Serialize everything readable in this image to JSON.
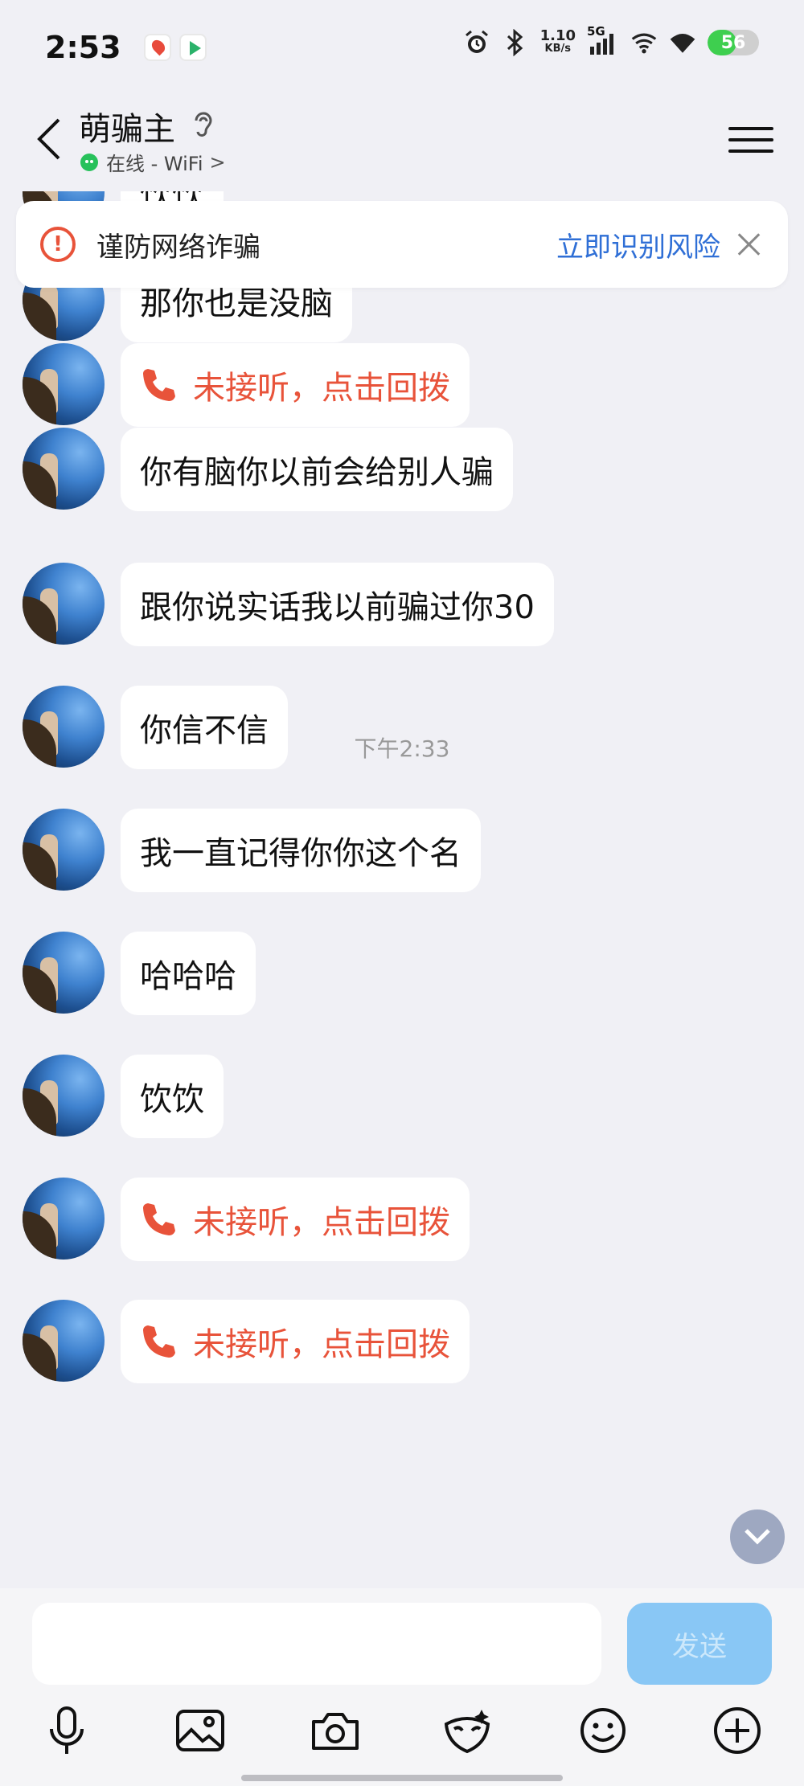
{
  "status_bar": {
    "time": "2:53",
    "net_speed": "1.10",
    "net_unit": "KB/s",
    "network_type": "5G",
    "battery_level": "56",
    "battery_fraction": 0.56
  },
  "header": {
    "contact_name": "萌骗主",
    "presence_text": "在线 - WiFi",
    "presence_chevron": ">"
  },
  "fraud_banner": {
    "warning_text": "谨防网络诈骗",
    "action_text": "立即识别风险",
    "warn_glyph": "!"
  },
  "messages": [
    {
      "type": "text",
      "text": "饮饮"
    },
    {
      "type": "text",
      "text": "那你也是没脑"
    },
    {
      "type": "call",
      "text": "未接听，点击回拨"
    },
    {
      "type": "text",
      "text": "你有脑你以前会给别人骗"
    },
    {
      "type": "text",
      "text": "跟你说实话我以前骗过你30"
    },
    {
      "type": "text",
      "text": "你信不信"
    },
    {
      "type": "text",
      "text": "我一直记得你你这个名"
    },
    {
      "type": "text",
      "text": "哈哈哈"
    },
    {
      "type": "text",
      "text": "饮饮"
    },
    {
      "type": "call",
      "text": "未接听，点击回拨"
    },
    {
      "type": "call",
      "text": "未接听，点击回拨"
    }
  ],
  "timestamp": "下午2:33",
  "input": {
    "value": "",
    "send_label": "发送"
  },
  "toolbar_icons": [
    "microphone-icon",
    "image-icon",
    "camera-icon",
    "sticker-icon",
    "emoji-icon",
    "plus-icon"
  ],
  "colors": {
    "call_red": "#e8533a",
    "link_blue": "#2f6fd6",
    "send_button": "#89c7f5",
    "background": "#f0f0f5"
  }
}
